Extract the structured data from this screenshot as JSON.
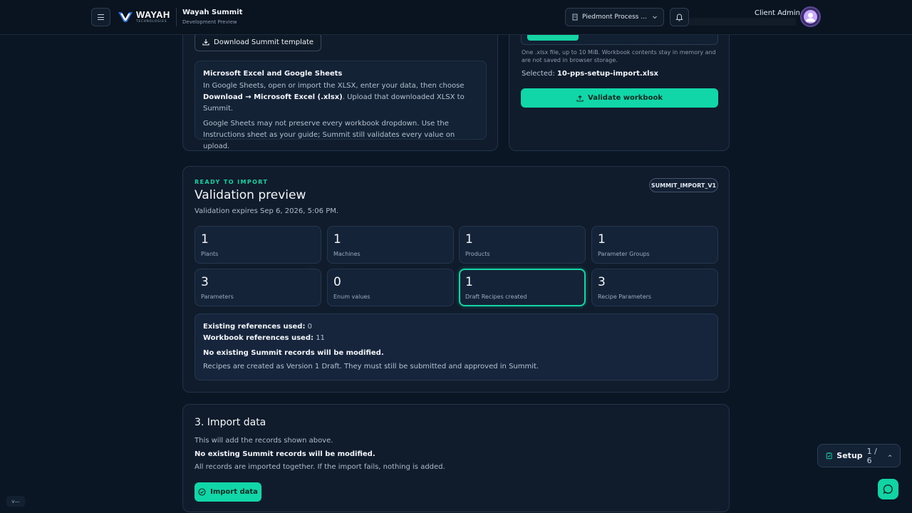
{
  "header": {
    "logo_word": "WAYAH",
    "logo_sub": "TECHNOLOGIES",
    "app_title": "Wayah Summit",
    "app_subtitle": "Development Preview",
    "org_select_value": "Piedmont Process ...",
    "user_name": "Client Admin"
  },
  "template_panel": {
    "download_button": "Download Summit template",
    "excel_heading": "Microsoft Excel and Google Sheets",
    "p1_a": "In Google Sheets, open or import the XLSX, enter your data, then choose ",
    "p1_bold": "Download → Microsoft Excel (.xlsx)",
    "p1_b": ". Upload that downloaded XLSX to Summit.",
    "p2": "Google Sheets may not preserve every workbook dropdown. Use the Instructions sheet as your guide; Summit still validates every value on upload."
  },
  "upload_panel": {
    "file_hint": "One .xlsx file, up to 10 MiB. Workbook contents stay in memory and are not saved in browser storage.",
    "selected_label": "Selected:",
    "selected_file": "10-pps-setup-import.xlsx",
    "validate_button": "Validate workbook"
  },
  "validation": {
    "eyebrow": "READY TO IMPORT",
    "title": "Validation preview",
    "badge": "SUMMIT_IMPORT_V1",
    "expires": "Validation expires Sep 6, 2026, 5:06 PM.",
    "stats": [
      {
        "value": "1",
        "label": "Plants"
      },
      {
        "value": "1",
        "label": "Machines"
      },
      {
        "value": "1",
        "label": "Products"
      },
      {
        "value": "1",
        "label": "Parameter Groups"
      },
      {
        "value": "3",
        "label": "Parameters"
      },
      {
        "value": "0",
        "label": "Enum values"
      },
      {
        "value": "1",
        "label": "Draft Recipes created"
      },
      {
        "value": "3",
        "label": "Recipe Parameters"
      }
    ],
    "existing_refs_label": "Existing references used:",
    "existing_refs_value": "0",
    "workbook_refs_label": "Workbook references used:",
    "workbook_refs_value": "11",
    "no_modify": "No existing Summit records will be modified.",
    "recipes_note": "Recipes are created as Version 1 Draft. They must still be submitted and approved in Summit."
  },
  "import_panel": {
    "title": "3. Import data",
    "line1": "This will add the records shown above.",
    "line2": "No existing Summit records will be modified.",
    "line3": "All records are imported together. If the import fails, nothing is added.",
    "button": "Import data"
  },
  "setup_widget": {
    "label": "Setup",
    "progress": "1 / 6"
  },
  "corner_tag": "v—",
  "colors": {
    "accent": "#11d6a8",
    "background": "#0b1624",
    "panel": "#101b2b"
  }
}
